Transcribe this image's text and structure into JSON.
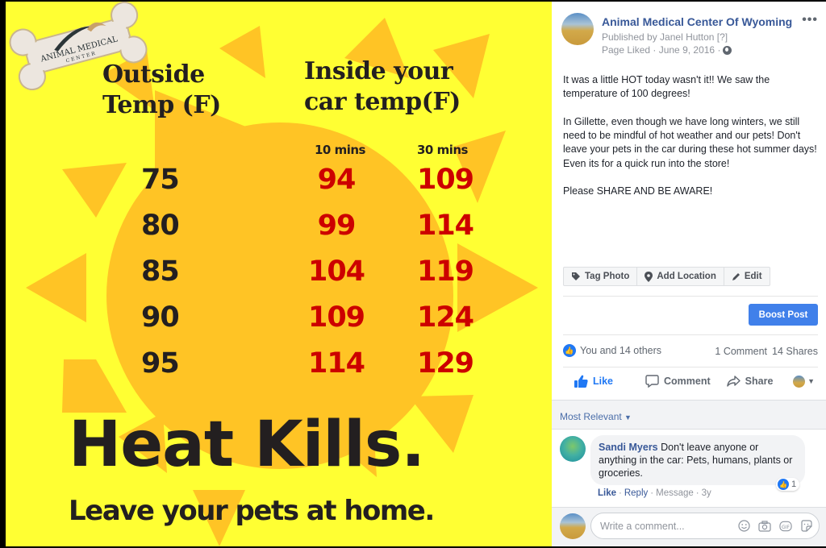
{
  "photo": {
    "logo": {
      "line1": "ANIMAL MEDICAL",
      "line2": "CENTER"
    },
    "headers": {
      "outside": [
        "Outside",
        "Temp (F)"
      ],
      "inside": [
        "Inside your",
        "car temp(F)"
      ],
      "sub_10": "10 mins",
      "sub_30": "30 mins"
    },
    "table": {
      "columns": [
        "Outside Temp (F)",
        "10 mins",
        "30 mins"
      ],
      "rows": [
        {
          "outside": "75",
          "ten": "94",
          "thirty": "109"
        },
        {
          "outside": "80",
          "ten": "99",
          "thirty": "114"
        },
        {
          "outside": "85",
          "ten": "104",
          "thirty": "119"
        },
        {
          "outside": "90",
          "ten": "109",
          "thirty": "124"
        },
        {
          "outside": "95",
          "ten": "114",
          "thirty": "129"
        }
      ]
    },
    "headline": "Heat Kills.",
    "tagline": "Leave your pets at home.",
    "colors": {
      "background": "#ffff33",
      "sun": "#ffc425",
      "text": "#231f20",
      "numbers": "#cc0000"
    }
  },
  "post": {
    "page_name": "Animal Medical Center Of Wyoming",
    "published_by": "Published by Janel Hutton [?]",
    "meta": "Page Liked · June 9, 2016 ·",
    "more_icon": "ellipsis-icon",
    "body": [
      "It was a little HOT today wasn't it!! We saw the temperature of 100 degrees!",
      "In Gillette, even though we have long winters, we still need to be mindful of hot weather and our pets! Don't leave your pets in the car during these hot summer days! Even its for a quick run into the store!",
      "Please SHARE AND BE AWARE!"
    ],
    "photo_actions": [
      {
        "label": "Tag Photo",
        "icon": "tag-icon"
      },
      {
        "label": "Add Location",
        "icon": "location-pin-icon"
      },
      {
        "label": "Edit",
        "icon": "pencil-icon"
      }
    ],
    "boost_label": "Boost Post",
    "reactions_text": "You and 14 others",
    "comments_count": "1 Comment",
    "shares_count": "14 Shares",
    "actions": {
      "like": "Like",
      "comment": "Comment",
      "share": "Share"
    },
    "accent_color": "#4080ea"
  },
  "comments": {
    "sort_label": "Most Relevant",
    "items": [
      {
        "author": "Sandi Myers",
        "text": "Don't leave anyone or anything in the car: Pets, humans, plants or groceries.",
        "reaction_count": "1",
        "like": "Like",
        "reply": "Reply",
        "message": "Message",
        "time": "3y"
      }
    ],
    "composer_placeholder": "Write a comment..."
  }
}
